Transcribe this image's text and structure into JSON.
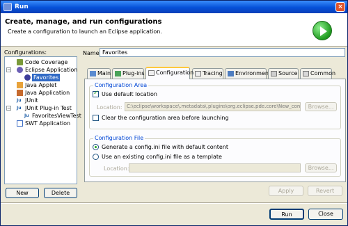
{
  "window": {
    "title": "Run"
  },
  "header": {
    "title": "Create, manage, and run configurations",
    "subtitle": "Create a configuration to launch an Eclipse application."
  },
  "configurations": {
    "label": "Configurations:",
    "tree": [
      {
        "label": "Code Coverage",
        "icon": "code-coverage-icon",
        "level": 1
      },
      {
        "label": "Eclipse Application",
        "icon": "eclipse-app-icon",
        "level": 1,
        "expanded": true
      },
      {
        "label": "Favorites",
        "icon": "eclipse-config-icon",
        "level": 2,
        "selected": true
      },
      {
        "label": "Java Applet",
        "icon": "java-applet-icon",
        "level": 1
      },
      {
        "label": "Java Application",
        "icon": "java-app-icon",
        "level": 1
      },
      {
        "label": "JUnit",
        "icon": "junit-icon",
        "level": 1
      },
      {
        "label": "JUnit Plug-in Test",
        "icon": "junit-plugin-icon",
        "level": 1,
        "expanded": true
      },
      {
        "label": "FavoritesViewTest",
        "icon": "junit-test-icon",
        "level": 2
      },
      {
        "label": "SWT Application",
        "icon": "swt-app-icon",
        "level": 1
      }
    ],
    "new_label": "New",
    "delete_label": "Delete"
  },
  "name": {
    "label": "Name:",
    "value": "Favorites"
  },
  "tabs": [
    {
      "label": "Main",
      "icon": "main-tab-icon"
    },
    {
      "label": "Plug-ins",
      "icon": "plugins-tab-icon"
    },
    {
      "label": "Configuration",
      "icon": "configuration-tab-icon",
      "active": true
    },
    {
      "label": "Tracing",
      "icon": "tracing-tab-icon"
    },
    {
      "label": "Environment",
      "icon": "environment-tab-icon"
    },
    {
      "label": "Source",
      "icon": "source-tab-icon"
    },
    {
      "label": "Common",
      "icon": "common-tab-icon"
    }
  ],
  "config_area": {
    "title": "Configuration Area",
    "use_default_label": "Use default location",
    "use_default_checked": true,
    "location_label": "Location:",
    "location_value": "C:\\eclipse\\workspace\\.metadata\\.plugins\\org.eclipse.pde.core\\New_configu",
    "browse_label": "Browse...",
    "clear_label": "Clear the configuration area before launching",
    "clear_checked": false
  },
  "config_file": {
    "title": "Configuration File",
    "generate_label": "Generate a config.ini file with default content",
    "existing_label": "Use an existing config.ini file as a template",
    "selected": "generate",
    "location_label": "Location:",
    "location_value": "",
    "browse_label": "Browse..."
  },
  "actions": {
    "apply_label": "Apply",
    "revert_label": "Revert",
    "run_label": "Run",
    "close_label": "Close"
  },
  "colors": {
    "title_bar": "#0550d8",
    "selection": "#316ac5",
    "group_title": "#0046d5",
    "active_tab_accent": "#ffc83c"
  }
}
